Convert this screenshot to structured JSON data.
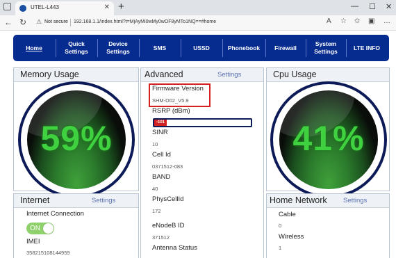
{
  "browser": {
    "tab_title": "UTEL-L443",
    "new_tab": "+",
    "not_secure": "Not secure",
    "url": "192.168.1.1/index.html?t=MjAyMi0wMy0wOF8yMTo1NQ==#home"
  },
  "nav": {
    "items": [
      {
        "label": "Home",
        "active": true
      },
      {
        "label": "Quick Settings"
      },
      {
        "label": "Device Settings"
      },
      {
        "label": "SMS"
      },
      {
        "label": "USSD"
      },
      {
        "label": "Phonebook"
      },
      {
        "label": "Firewall"
      },
      {
        "label": "System Settings"
      },
      {
        "label": "LTE INFO"
      }
    ]
  },
  "memory": {
    "title": "Memory Usage",
    "value": "59%"
  },
  "cpu": {
    "title": "Cpu Usage",
    "value": "41%"
  },
  "advanced": {
    "title": "Advanced",
    "settings": "Settings",
    "firmware_label": "Firmware Version",
    "firmware_value": "SHM-D02_V5.9",
    "rsrp_label": "RSRP (dBm)",
    "rsrp_value": "-101",
    "rsrp_level": 0.13,
    "sinr_label": "SINR",
    "sinr_value": "10",
    "cellid_label": "Cell Id",
    "cellid_value": "0371512-083",
    "band_label": "BAND",
    "band_value": "40",
    "phys_label": "PhysCellId",
    "phys_value": "172",
    "enodeb_label": "eNodeB ID",
    "enodeb_value": "371512",
    "antenna_label": "Antenna Status"
  },
  "internet": {
    "title": "Internet",
    "settings": "Settings",
    "conn_label": "Internet Connection",
    "toggle": "ON",
    "imei_label": "IMEI",
    "imei_value": "358215108144959"
  },
  "home_network": {
    "title": "Home Network",
    "settings": "Settings",
    "cable_label": "Cable",
    "cable_value": "0",
    "wireless_label": "Wireless",
    "wireless_value": "1"
  },
  "colors": {
    "nav_bg": "#072c8f",
    "gauge_green": "#3fd13f",
    "highlight": "#d61f1f",
    "rsrp": "#d32020"
  }
}
